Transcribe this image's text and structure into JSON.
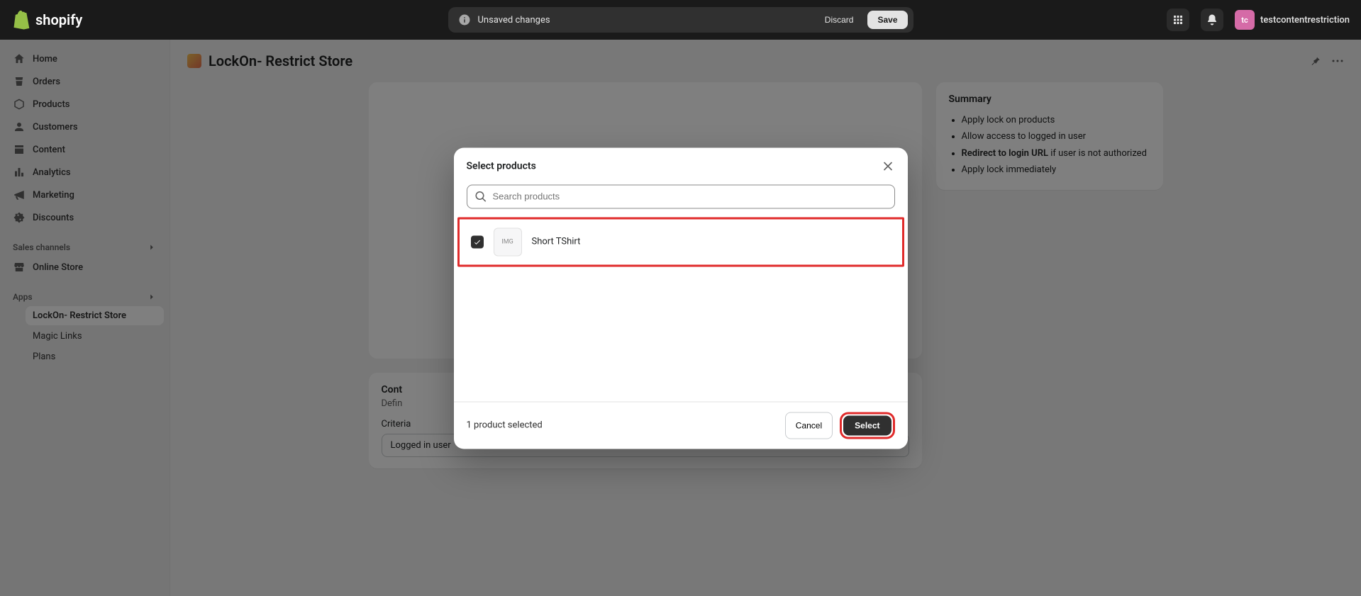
{
  "topbar": {
    "brand": "shopify",
    "unsaved_label": "Unsaved changes",
    "discard_label": "Discard",
    "save_label": "Save",
    "user_name": "testcontentrestriction",
    "avatar_initials": "tc"
  },
  "sidebar": {
    "items": [
      {
        "label": "Home",
        "icon": "home"
      },
      {
        "label": "Orders",
        "icon": "orders"
      },
      {
        "label": "Products",
        "icon": "products"
      },
      {
        "label": "Customers",
        "icon": "customers"
      },
      {
        "label": "Content",
        "icon": "content"
      },
      {
        "label": "Analytics",
        "icon": "analytics"
      },
      {
        "label": "Marketing",
        "icon": "marketing"
      },
      {
        "label": "Discounts",
        "icon": "discounts"
      }
    ],
    "sales_section": "Sales channels",
    "sales_items": [
      {
        "label": "Online Store",
        "icon": "store"
      }
    ],
    "apps_section": "Apps",
    "apps_items": [
      {
        "label": "LockOn- Restrict Store",
        "active": true
      },
      {
        "label": "Magic Links",
        "active": false
      },
      {
        "label": "Plans",
        "active": false
      }
    ]
  },
  "page": {
    "title": "LockOn- Restrict Store"
  },
  "control": {
    "heading_prefix": "Cont",
    "sub_prefix": "Defin",
    "criteria_label": "Criteria",
    "criteria_value": "Logged in user"
  },
  "summary": {
    "title": "Summary",
    "items": [
      {
        "text": "Apply lock on products"
      },
      {
        "text": "Allow access to logged in user"
      },
      {
        "strong": "Redirect to login URL",
        "rest": " if user is not authorized"
      },
      {
        "text": "Apply lock immediately"
      }
    ]
  },
  "modal": {
    "title": "Select products",
    "search_placeholder": "Search products",
    "products": [
      {
        "name": "Short TShirt",
        "checked": true
      }
    ],
    "selected_text": "1 product selected",
    "cancel_label": "Cancel",
    "select_label": "Select"
  }
}
